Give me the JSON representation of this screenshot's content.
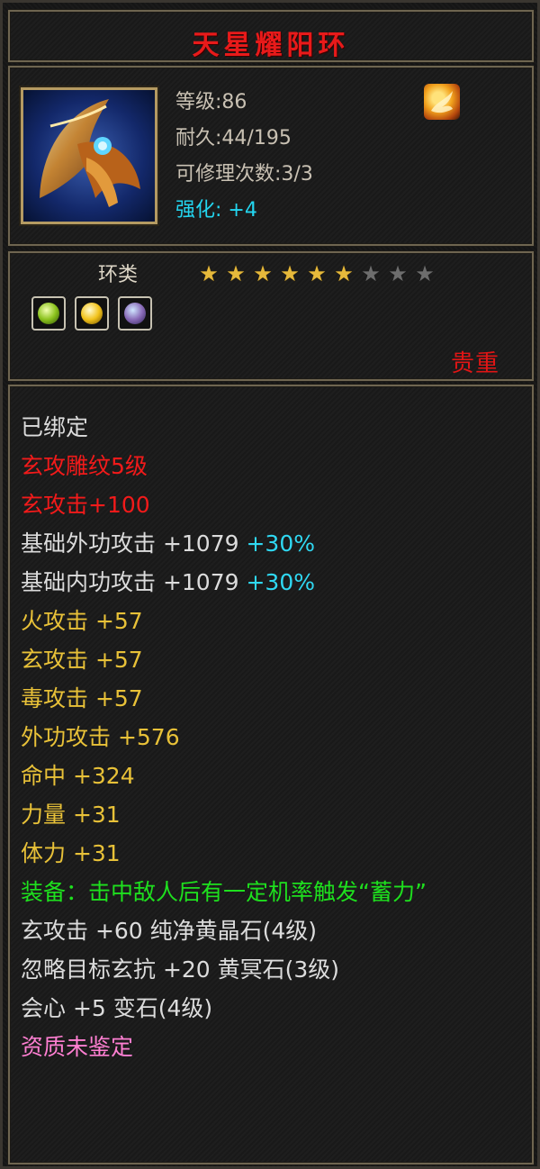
{
  "item": {
    "name": "天星耀阳环",
    "level": "等级:86",
    "durability": "耐久:44/195",
    "repair": "可修理次数:3/3",
    "enhance_label": "强化:",
    "enhance_value": "+4",
    "category": "环类",
    "stars_total": 9,
    "stars_filled": 6,
    "rarity": "贵重"
  },
  "attributes": {
    "bound": "已绑定",
    "engrave": "玄攻雕纹5级",
    "engrave_bonus": "玄攻击+100",
    "base_outer": "基础外功攻击 +1079",
    "base_outer_pct": "+30%",
    "base_inner": "基础内功攻击 +1079",
    "base_inner_pct": "+30%",
    "fire": "火攻击 +57",
    "xuan": "玄攻击 +57",
    "poison": "毒攻击 +57",
    "outer_attack": "外功攻击 +576",
    "hit": "命中 +324",
    "strength": "力量 +31",
    "stamina": "体力 +31",
    "equip_effect": "装备：击中敌人后有一定机率触发“蓄力”",
    "gem1": "玄攻击 +60 纯净黄晶石(4级)",
    "gem2": "忽略目标玄抗 +20 黄冥石(3级)",
    "gem3": "会心 +5 变石(4级)",
    "quality": "资质未鉴定"
  },
  "colors": {
    "title": "#e81a1a",
    "enhance": "#23d6f0",
    "star_on": "#e6b93b",
    "star_off": "#6d6d6d",
    "red": "#f21a1a",
    "yellow": "#e8c138",
    "green": "#1ee01e",
    "pink": "#ff7fd2",
    "cyan": "#2fd8f2"
  },
  "icons": {
    "portrait": "dragon-ring-portrait",
    "element": "fire-element-icon",
    "gems": [
      "green-gem-icon",
      "yellow-gem-icon",
      "purple-gem-icon"
    ]
  }
}
